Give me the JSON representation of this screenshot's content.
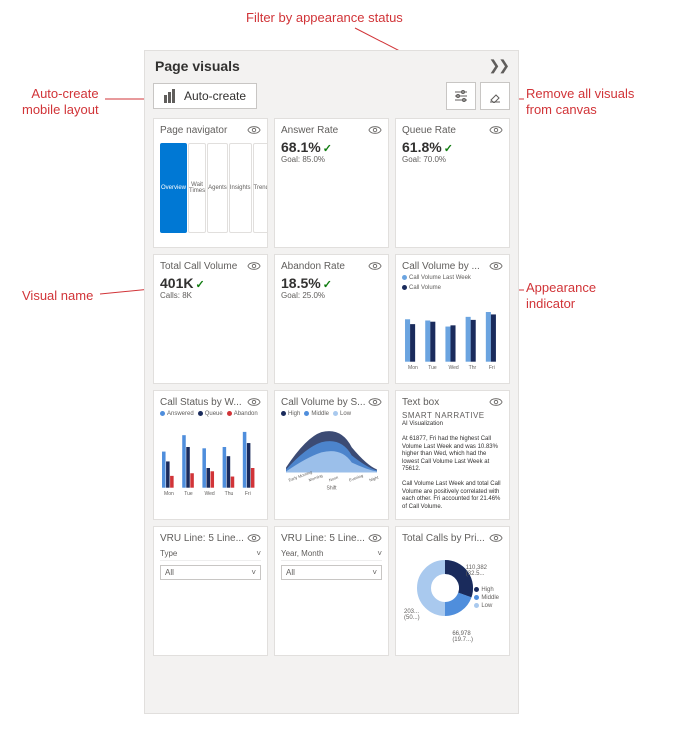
{
  "annotations": {
    "auto_create": "Auto-create\nmobile layout",
    "filter": "Filter by appearance status",
    "remove": "Remove all visuals\nfrom canvas",
    "vname": "Visual name",
    "indicator": "Appearance\nindicator"
  },
  "panel": {
    "title": "Page visuals"
  },
  "toolbar": {
    "auto_create_label": "Auto-create"
  },
  "cards": [
    {
      "title": "Page navigator",
      "type": "pagenav",
      "tabs": [
        "Overview",
        "Wait Times",
        "Agents",
        "Insights",
        "Trends"
      ],
      "active_index": 0
    },
    {
      "title": "Answer Rate",
      "type": "kpi",
      "value": "68.1%",
      "goal": "Goal: 85.0%"
    },
    {
      "title": "Queue Rate",
      "type": "kpi",
      "value": "61.8%",
      "goal": "Goal: 70.0%"
    },
    {
      "title": "Total Call Volume",
      "type": "kpi",
      "value": "401K",
      "goal": "Calls: 8K"
    },
    {
      "title": "Abandon Rate",
      "type": "kpi",
      "value": "18.5%",
      "goal": "Goal: 25.0%"
    },
    {
      "title": "Call Volume by ...",
      "type": "barchart_dual",
      "legend": [
        "Call Volume Last Week",
        "Call Volume"
      ],
      "categories": [
        "Mon",
        "Tue",
        "Wed",
        "Thr",
        "Fri"
      ],
      "series": [
        {
          "name": "Call Volume Last Week",
          "color": "#6ba4e0",
          "values": [
            70,
            68,
            58,
            74,
            82
          ]
        },
        {
          "name": "Call Volume",
          "color": "#1a2b5c",
          "values": [
            62,
            66,
            60,
            69,
            78
          ]
        }
      ]
    },
    {
      "title": "Call Status by W...",
      "type": "barchart_tri",
      "legend": [
        "Answered",
        "Queue",
        "Abandon"
      ],
      "colors": [
        "#4f8edc",
        "#1a2b5c",
        "#d13438"
      ],
      "categories": [
        "Mon",
        "Tue",
        "Wed",
        "Thu",
        "Fri"
      ],
      "series": [
        {
          "name": "Answered",
          "values": [
            55,
            80,
            60,
            62,
            85
          ]
        },
        {
          "name": "Queue",
          "values": [
            40,
            62,
            30,
            48,
            68
          ]
        },
        {
          "name": "Abandon",
          "values": [
            18,
            22,
            25,
            17,
            30
          ]
        }
      ]
    },
    {
      "title": "Call Volume by S...",
      "type": "area",
      "legend": [
        "High",
        "Middle",
        "Low"
      ],
      "colors": [
        "#1a2b5c",
        "#4f8edc",
        "#a9c9ee"
      ],
      "categories": [
        "Early Morning",
        "Morning",
        "Noon",
        "Evening",
        "Night"
      ]
    },
    {
      "title": "Text box",
      "type": "text",
      "heading": "SMART NARRATIVE",
      "sub": "AI Visualization",
      "body": "At 61877, Fri had the highest Call Volume Last Week and was 10.83% higher than Wed, which had the lowest Call Volume Last Week at 75612.\n\nCall Volume Last Week and total Call Volume are positively correlated with each other. Fri accounted for 21.46% of Call Volume.\n\nCall Volume and Call Volume Last W..."
    },
    {
      "title": "VRU Line: 5 Line...",
      "type": "slicer",
      "label": "Type",
      "value": "All"
    },
    {
      "title": "VRU Line: 5 Line...",
      "type": "slicer",
      "label": "Year, Month",
      "value": "All"
    },
    {
      "title": "Total Calls by Pri...",
      "type": "donut",
      "segments": [
        {
          "label": "High",
          "value": "110,382",
          "pct": "(32.5...",
          "color": "#1a2b5c"
        },
        {
          "label": "Middle",
          "value": "66,978",
          "pct": "(19.7...)",
          "color": "#4f8edc"
        },
        {
          "label": "Low",
          "value": "",
          "pct": "",
          "color": "#a9c9ee"
        }
      ],
      "outer_labels": [
        {
          "text": "203...",
          "sub": "(50...)"
        }
      ]
    }
  ],
  "chart_data": [
    {
      "card_index": 5,
      "type": "bar",
      "title": "Call Volume by ...",
      "categories": [
        "Mon",
        "Tue",
        "Wed",
        "Thr",
        "Fri"
      ],
      "series": [
        {
          "name": "Call Volume Last Week",
          "values": [
            70,
            68,
            58,
            74,
            82
          ]
        },
        {
          "name": "Call Volume",
          "values": [
            62,
            66,
            60,
            69,
            78
          ]
        }
      ],
      "ylabel_left": "Call Volume Last Week",
      "ylabel_right": "Call Volume"
    },
    {
      "card_index": 6,
      "type": "bar",
      "title": "Call Status by W...",
      "categories": [
        "Mon",
        "Tue",
        "Wed",
        "Thu",
        "Fri"
      ],
      "series": [
        {
          "name": "Answered",
          "values": [
            55,
            80,
            60,
            62,
            85
          ]
        },
        {
          "name": "Queue",
          "values": [
            40,
            62,
            30,
            48,
            68
          ]
        },
        {
          "name": "Abandon",
          "values": [
            18,
            22,
            25,
            17,
            30
          ]
        }
      ]
    },
    {
      "card_index": 7,
      "type": "area",
      "title": "Call Volume by S...",
      "categories": [
        "Early Morning",
        "Morning",
        "Noon",
        "Evening",
        "Night"
      ],
      "series": [
        {
          "name": "High",
          "values": [
            20,
            42,
            55,
            34,
            15
          ]
        },
        {
          "name": "Middle",
          "values": [
            15,
            30,
            40,
            25,
            10
          ]
        },
        {
          "name": "Low",
          "values": [
            10,
            20,
            28,
            18,
            6
          ]
        }
      ],
      "xlabel": "Shift"
    },
    {
      "card_index": 11,
      "type": "pie",
      "title": "Total Calls by Pri...",
      "segments": [
        {
          "name": "High",
          "value": 110382,
          "pct": 32.5
        },
        {
          "name": "Middle",
          "value": 66978,
          "pct": 19.7
        },
        {
          "name": "Low",
          "value": 203000,
          "pct": 50.0
        }
      ]
    }
  ]
}
